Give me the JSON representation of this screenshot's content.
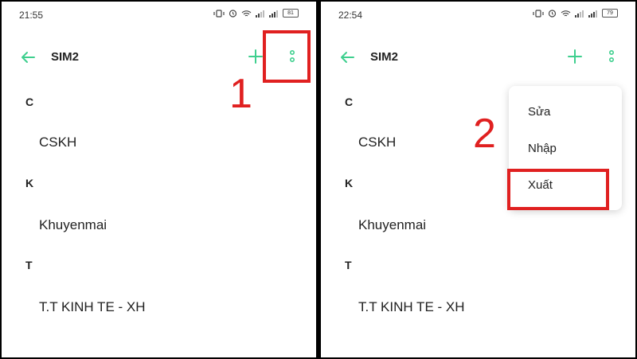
{
  "left": {
    "time": "21:55",
    "battery": "81",
    "title": "SIM2",
    "step": "1",
    "sections": [
      {
        "letter": "C",
        "contact": "CSKH"
      },
      {
        "letter": "K",
        "contact": "Khuyenmai"
      },
      {
        "letter": "T",
        "contact": "T.T KINH TE - XH"
      }
    ]
  },
  "right": {
    "time": "22:54",
    "battery": "79",
    "title": "SIM2",
    "step": "2",
    "sections": [
      {
        "letter": "C",
        "contact": "CSKH"
      },
      {
        "letter": "K",
        "contact": "Khuyenmai"
      },
      {
        "letter": "T",
        "contact": "T.T KINH TE - XH"
      }
    ],
    "menu": [
      "Sửa",
      "Nhập",
      "Xuất"
    ]
  },
  "colors": {
    "accent": "#3ecf8e",
    "highlight": "#e02020"
  },
  "icons": [
    "back-arrow-icon",
    "add-icon",
    "more-vertical-icon",
    "vibrate-icon",
    "alarm-icon",
    "wifi-icon",
    "signal-icon",
    "battery-icon"
  ]
}
